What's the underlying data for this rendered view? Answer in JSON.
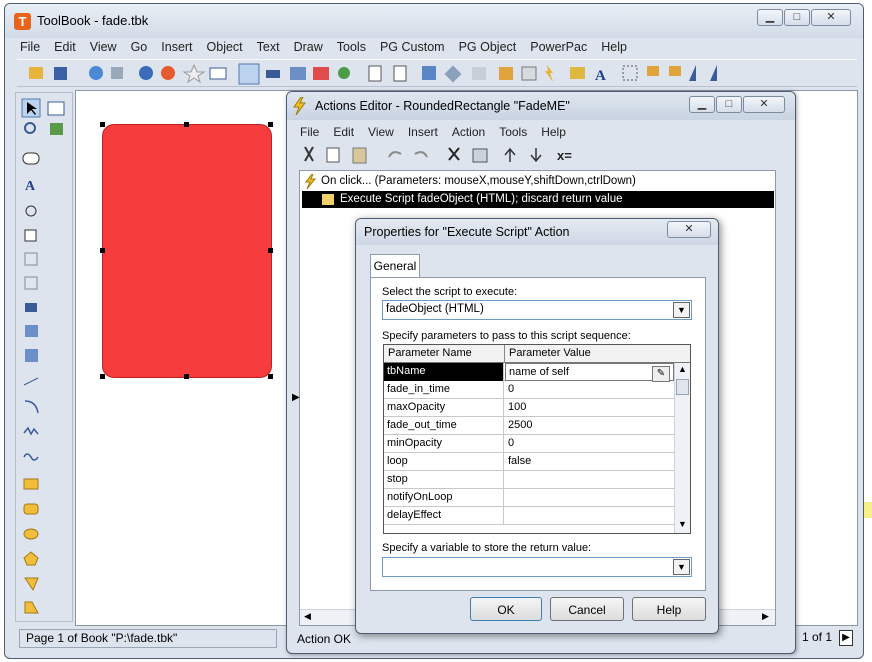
{
  "app": {
    "title": "ToolBook - fade.tbk",
    "logo_letter": "T",
    "menu": [
      "File",
      "Edit",
      "View",
      "Go",
      "Insert",
      "Object",
      "Text",
      "Draw",
      "Tools",
      "PG Custom",
      "PG Object",
      "PowerPac",
      "Help"
    ]
  },
  "status": {
    "left": "Page 1 of Book \"P:\\fade.tbk\"",
    "page": "1 of 1"
  },
  "editor": {
    "title": "Actions Editor - RoundedRectangle \"FadeME\"",
    "menu": [
      "File",
      "Edit",
      "View",
      "Insert",
      "Action",
      "Tools",
      "Help"
    ],
    "tree": {
      "handler": "On click... (Parameters: mouseX,mouseY,shiftDown,ctrlDown)",
      "action": "Execute Script fadeObject (HTML); discard return value"
    },
    "status": "Action OK"
  },
  "dialog": {
    "title": "Properties for \"Execute Script\" Action",
    "tab": "General",
    "script_label": "Select the script to execute:",
    "script_value": "fadeObject (HTML)",
    "params_label": "Specify parameters to pass to this script sequence:",
    "col_name": "Parameter Name",
    "col_value": "Parameter Value",
    "params": [
      {
        "name": "tbName",
        "value": "name of self"
      },
      {
        "name": "fade_in_time",
        "value": "0"
      },
      {
        "name": "maxOpacity",
        "value": "100"
      },
      {
        "name": "fade_out_time",
        "value": "2500"
      },
      {
        "name": "minOpacity",
        "value": "0"
      },
      {
        "name": "loop",
        "value": "false"
      },
      {
        "name": "stop",
        "value": ""
      },
      {
        "name": "notifyOnLoop",
        "value": ""
      },
      {
        "name": "delayEffect",
        "value": ""
      }
    ],
    "return_label": "Specify a variable to store the return value:",
    "return_value": "",
    "ok": "OK",
    "cancel": "Cancel",
    "help": "Help"
  },
  "colors": {
    "shape_fill": "#f63c3c",
    "selection": "#000000",
    "title_gradient": "#c9d4e2"
  }
}
